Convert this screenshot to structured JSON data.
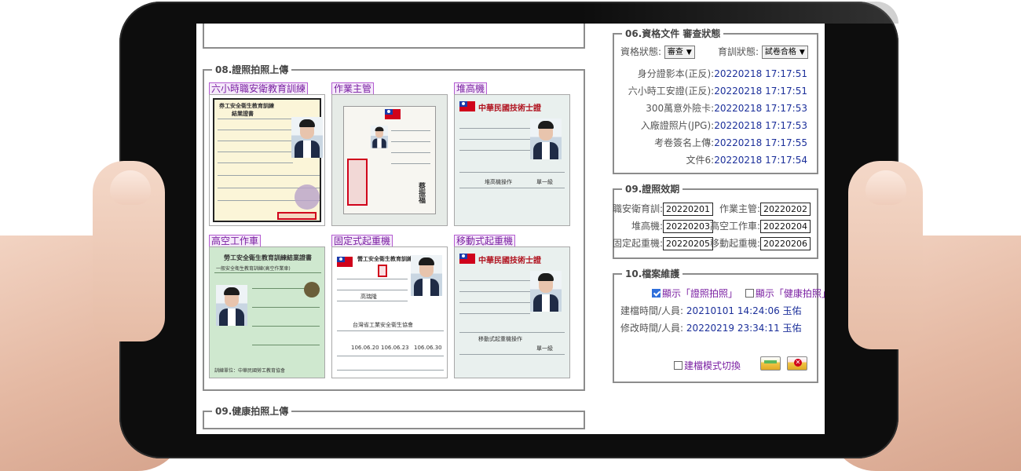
{
  "section_08": {
    "title": "08.證照拍照上傳",
    "items": [
      {
        "label": "六小時職安衛教育訓練"
      },
      {
        "label": "作業主管"
      },
      {
        "label": "堆高機"
      },
      {
        "label": "高空工作車"
      },
      {
        "label": "固定式起重機"
      },
      {
        "label": "移動式起重機"
      }
    ]
  },
  "section_09_health": {
    "title": "09.健康拍照上傳"
  },
  "section_06": {
    "title": "06.資格文件 審查狀態",
    "qualification_label": "資格狀態:",
    "qualification_value": "審查",
    "training_label": "育訓狀態:",
    "training_value": "試卷合格",
    "rows": [
      {
        "label": "身分證影本(正反):",
        "value": "20220218 17:17:51"
      },
      {
        "label": "六小時工安證(正反):",
        "value": "20220218 17:17:51"
      },
      {
        "label": "300萬意外險卡:",
        "value": "20220218 17:17:53"
      },
      {
        "label": "入廠證照片(JPG):",
        "value": "20220218 17:17:53"
      },
      {
        "label": "考卷簽名上傳:",
        "value": "20220218 17:17:55"
      },
      {
        "label": "文件6:",
        "value": "20220218 17:17:54"
      }
    ]
  },
  "section_09_validity": {
    "title": "09.證照效期",
    "rows": [
      {
        "label_a": "職安衛育訓:",
        "value_a": "20220201",
        "label_b": "作業主管:",
        "value_b": "20220202"
      },
      {
        "label_a": "堆高機:",
        "value_a": "20220203",
        "label_b": "高空工作車:",
        "value_b": "20220204"
      },
      {
        "label_a": "固定起重機:",
        "value_a": "20220205",
        "label_b": "移動起重機:",
        "value_b": "20220206"
      }
    ]
  },
  "section_10": {
    "title": "10.檔案維護",
    "show_cert_photo": "顯示「證照拍照」",
    "show_health_photo": "顯示「健康拍照」",
    "created_label": "建檔時間/人員:",
    "created_value": "20210101 14:24:06 玉佑",
    "modified_label": "修改時間/人員:",
    "modified_value": "20220219 23:34:11 玉佑",
    "mode_switch": "建檔模式切換"
  },
  "cards": {
    "card1_title": "券工安全衛生教育訓練",
    "card1_sub": "結業證書",
    "card4_title": "勞工安全衛生教育訓練結業證書",
    "card4_sub": "一般安全衛生教育訓練(高空作業車)",
    "card4_footer": "訓練單位：中華民國勞工教育協會",
    "card5_title": "營工安全衛生教育訓練",
    "card5_mid": "台灣省工業安全衛生協會",
    "card6_title": "中華民國技術士證",
    "card3_title": "中華民國技術士證",
    "card3_name": "堆高機操作",
    "card6_name": "移動式起重機操作",
    "card2_name": "蔡振福",
    "card5_name": "高瑞隆",
    "card5_date_a": "106.06.20",
    "card5_date_b": "106.06.23",
    "card5_date_c": "106.06.30",
    "card3_grade": "單一級",
    "card6_grade": "單一級"
  },
  "colors": {
    "accent_purple": "#7a1fa2",
    "value_blue": "#1b2f9a",
    "frame_gray": "#8c8c8c"
  }
}
